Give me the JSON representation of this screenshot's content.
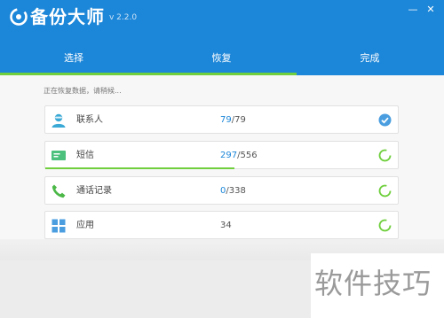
{
  "app": {
    "name": "备份大师",
    "version": "v 2.2.0"
  },
  "window_controls": {
    "minimize": "—",
    "close": "✕"
  },
  "tabs": [
    {
      "label": "选择"
    },
    {
      "label": "恢复"
    },
    {
      "label": "完成"
    }
  ],
  "tab_progress_fraction": 0.667,
  "status_text": "正在恢复数据，请稍候...",
  "items": [
    {
      "label": "联系人",
      "count_done": "79",
      "count_total": "/79",
      "icon": "contact-icon",
      "state": "done",
      "progress_fraction": 1.0
    },
    {
      "label": "短信",
      "count_done": "297",
      "count_total": "/556",
      "icon": "sms-icon",
      "state": "in-progress",
      "progress_fraction": 0.534
    },
    {
      "label": "通话记录",
      "count_done": "0",
      "count_total": "/338",
      "icon": "phone-icon",
      "state": "pending",
      "progress_fraction": 0
    },
    {
      "label": "应用",
      "count_done": "34",
      "count_total": "",
      "icon": "apps-icon",
      "state": "pending",
      "progress_fraction": 0
    }
  ],
  "watermark": {
    "text": "软件技巧"
  },
  "colors": {
    "brand_blue": "#1c86d8",
    "progress_green": "#6fcf3d",
    "check_blue": "#4a9ee0"
  }
}
